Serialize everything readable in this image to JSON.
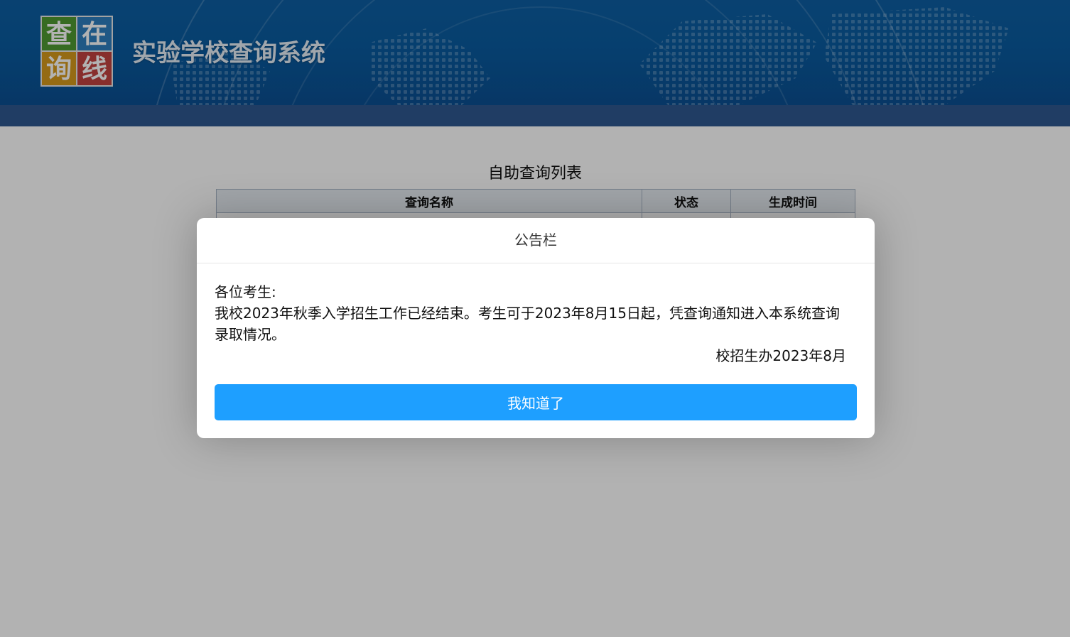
{
  "header": {
    "logo": {
      "chars": [
        "查",
        "在",
        "询",
        "线"
      ]
    },
    "title": "实验学校查询系统"
  },
  "main": {
    "list_title": "自助查询列表",
    "table": {
      "columns": [
        "查询名称",
        "状态",
        "生成时间"
      ]
    }
  },
  "dialog": {
    "title": "公告栏",
    "greeting": "各位考生:",
    "message": "我校2023年秋季入学招生工作已经结束。考生可于2023年8月15日起，凭查询通知进入本系统查询录取情况。",
    "signature": "校招生办2023年8月",
    "ok_label": "我知道了"
  },
  "colors": {
    "header_bg": "#0a5b9f",
    "nav_bar": "#2e5890",
    "button": "#1e9fff",
    "overlay": "rgba(0,0,0,0.30)"
  }
}
